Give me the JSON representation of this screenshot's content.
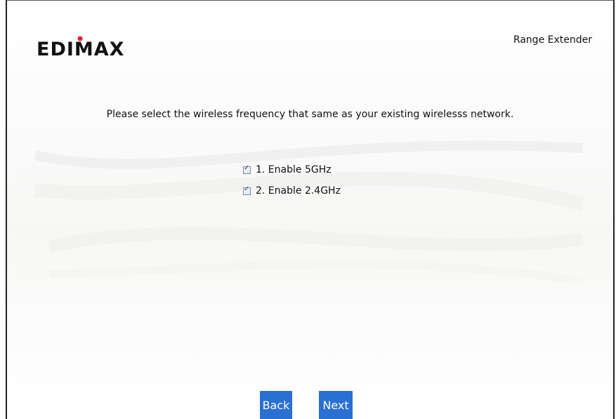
{
  "header": {
    "logo_text": "EDIMAX",
    "product_title": "Range Extender"
  },
  "main": {
    "instruction": "Please select the wireless frequency that same as your existing wirelesss network.",
    "options": [
      {
        "label": "1. Enable 5GHz",
        "checked": true
      },
      {
        "label": "2. Enable 2.4GHz",
        "checked": true
      }
    ]
  },
  "buttons": {
    "back_label": "Back",
    "next_label": "Next"
  },
  "colors": {
    "button_bg": "#2a6fd3",
    "logo_dot": "#e1242b",
    "logo_text": "#111111"
  },
  "icons": {
    "checkbox_checked": "check-icon"
  }
}
